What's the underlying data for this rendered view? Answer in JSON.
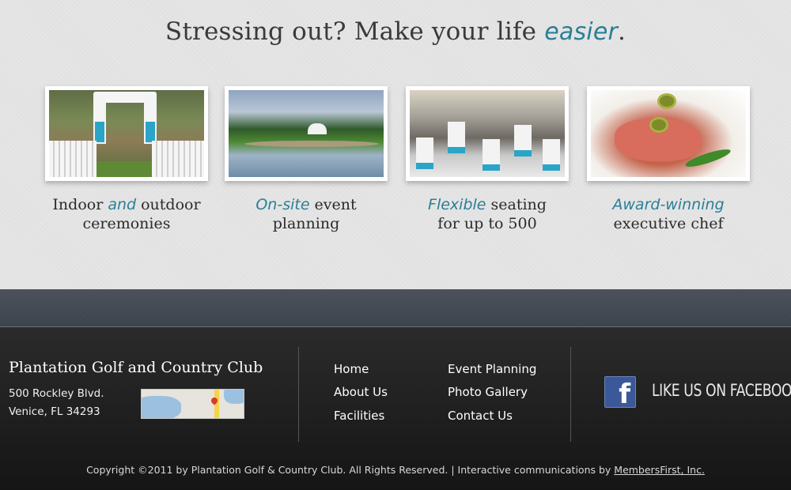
{
  "headline": {
    "text": "Stressing out? Make your life ",
    "accent": "easier",
    "end": "."
  },
  "features": [
    {
      "pre": "Indoor ",
      "script": "and",
      "post": " outdoor",
      "line2": "ceremonies",
      "image": "wedding-ceremony-photo"
    },
    {
      "pre": "",
      "script": "On-site",
      "post": " event",
      "line2": "planning",
      "image": "golf-course-photo"
    },
    {
      "pre": "",
      "script": "Flexible",
      "post": " seating",
      "line2": "for up to 500",
      "image": "banquet-hall-photo"
    },
    {
      "pre": "",
      "script": "Award-winning",
      "post": "",
      "line2": "executive chef",
      "image": "appetizer-photo"
    }
  ],
  "footer": {
    "club_name": "Plantation Golf and Country Club",
    "address_line1": "500 Rockley Blvd.",
    "address_line2": "Venice, FL 34293",
    "nav_left": [
      "Home",
      "About Us",
      "Facilities"
    ],
    "nav_right": [
      "Event Planning",
      "Photo Gallery",
      "Contact Us"
    ],
    "facebook_label": "LIKE US ON FACEBOOK",
    "facebook_glyph": "f",
    "copyright": "Copyright ©2011 by Plantation Golf & Country Club. All Rights Reserved. | Interactive communications by ",
    "credit_link": "MembersFirst, Inc."
  },
  "colors": {
    "accent": "#2a7f96",
    "facebook": "#3b5998",
    "footer_bg": "#1e1e1e",
    "top_bg": "#e3e3e3"
  }
}
